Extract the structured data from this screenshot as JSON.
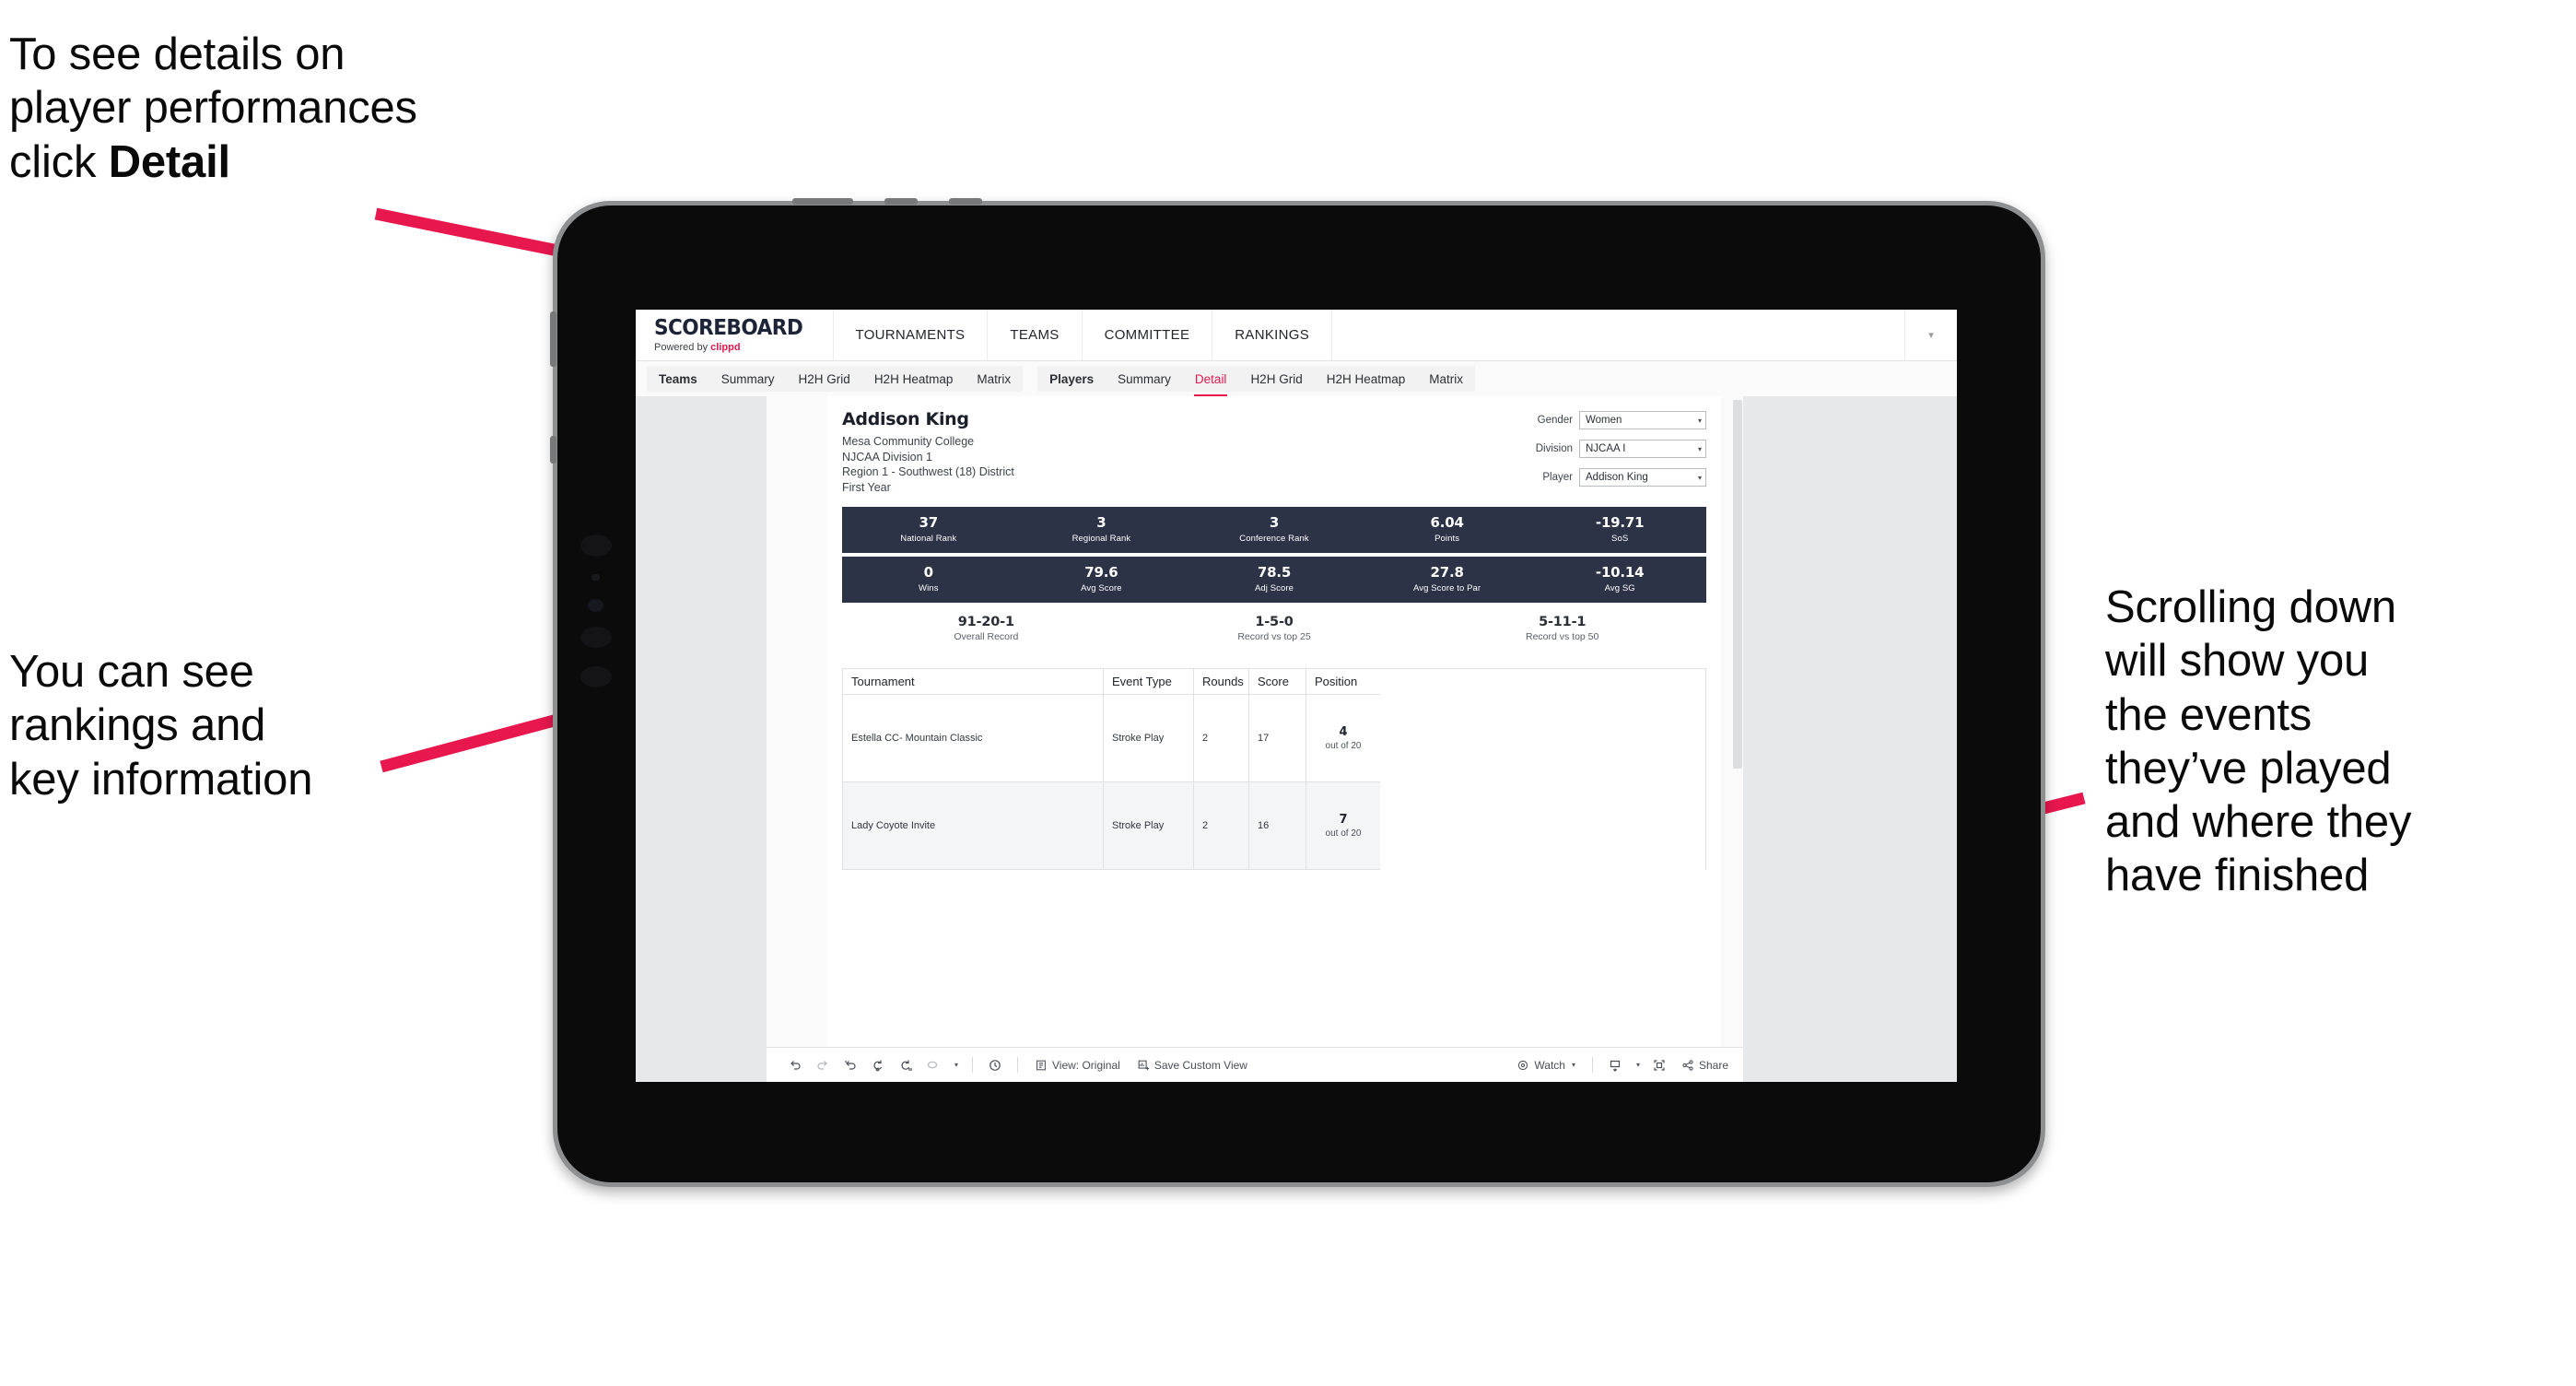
{
  "annotations": {
    "detail": "To see details on\nplayer performances\nclick ",
    "detail_bold": "Detail",
    "rankings": "You can see\nrankings and\nkey information",
    "scrolling": "Scrolling down\nwill show you\nthe events\nthey’ve played\nand where they\nhave finished"
  },
  "colors": {
    "accent_pink": "#e8184e",
    "stat_navy": "#2d3347",
    "screen_bg": "#e6e8ea"
  },
  "topnav": {
    "brand_title": "SCOREBOARD",
    "brand_sub_prefix": "Powered by ",
    "brand_sub_name": "clippd",
    "items": [
      "TOURNAMENTS",
      "TEAMS",
      "COMMITTEE",
      "RANKINGS"
    ],
    "caret_icon": "chevron-down-icon"
  },
  "tabbar": {
    "group_teams": [
      "Teams",
      "Summary",
      "H2H Grid",
      "H2H Heatmap",
      "Matrix"
    ],
    "group_players": [
      "Players",
      "Summary",
      "Detail",
      "H2H Grid",
      "H2H Heatmap",
      "Matrix"
    ],
    "active_tab": "Detail"
  },
  "player": {
    "name": "Addison King",
    "school": "Mesa Community College",
    "division_line": "NJCAA Division 1",
    "region_line": "Region 1 - Southwest (18) District",
    "class_year": "First Year"
  },
  "filters": [
    {
      "label": "Gender",
      "value": "Women"
    },
    {
      "label": "Division",
      "value": "NJCAA I"
    },
    {
      "label": "Player",
      "value": "Addison King"
    }
  ],
  "stats_row1": [
    {
      "value": "37",
      "label": "National Rank"
    },
    {
      "value": "3",
      "label": "Regional Rank"
    },
    {
      "value": "3",
      "label": "Conference Rank"
    },
    {
      "value": "6.04",
      "label": "Points"
    },
    {
      "value": "-19.71",
      "label": "SoS"
    }
  ],
  "stats_row2": [
    {
      "value": "0",
      "label": "Wins"
    },
    {
      "value": "79.6",
      "label": "Avg Score"
    },
    {
      "value": "78.5",
      "label": "Adj Score"
    },
    {
      "value": "27.8",
      "label": "Avg Score to Par"
    },
    {
      "value": "-10.14",
      "label": "Avg SG"
    }
  ],
  "records": [
    {
      "value": "91-20-1",
      "label": "Overall Record"
    },
    {
      "value": "1-5-0",
      "label": "Record vs top 25"
    },
    {
      "value": "5-11-1",
      "label": "Record vs top 50"
    }
  ],
  "table": {
    "headers": [
      "Tournament",
      "Event Type",
      "Rounds",
      "Score",
      "Position"
    ],
    "rows": [
      {
        "tournament": "Estella CC- Mountain Classic",
        "event_type": "Stroke Play",
        "rounds": "2",
        "score": "17",
        "position_num": "4",
        "position_sub": "out of 20"
      },
      {
        "tournament": "Lady Coyote Invite",
        "event_type": "Stroke Play",
        "rounds": "2",
        "score": "16",
        "position_num": "7",
        "position_sub": "out of 20"
      }
    ]
  },
  "toolbar": {
    "icons": [
      "undo-icon",
      "redo-icon",
      "revert-icon",
      "refresh-icon",
      "pause-icon",
      "zoom-icon",
      "clock-icon"
    ],
    "view_label": "View: Original",
    "save_label": "Save Custom View",
    "watch_label": "Watch",
    "share_label": "Share",
    "download_icon": "download-icon",
    "fullscreen_icon": "fullscreen-icon",
    "share_icon": "share-icon",
    "view_icon": "view-icon",
    "save_icon": "save-view-icon",
    "watch_icon": "watch-icon"
  }
}
